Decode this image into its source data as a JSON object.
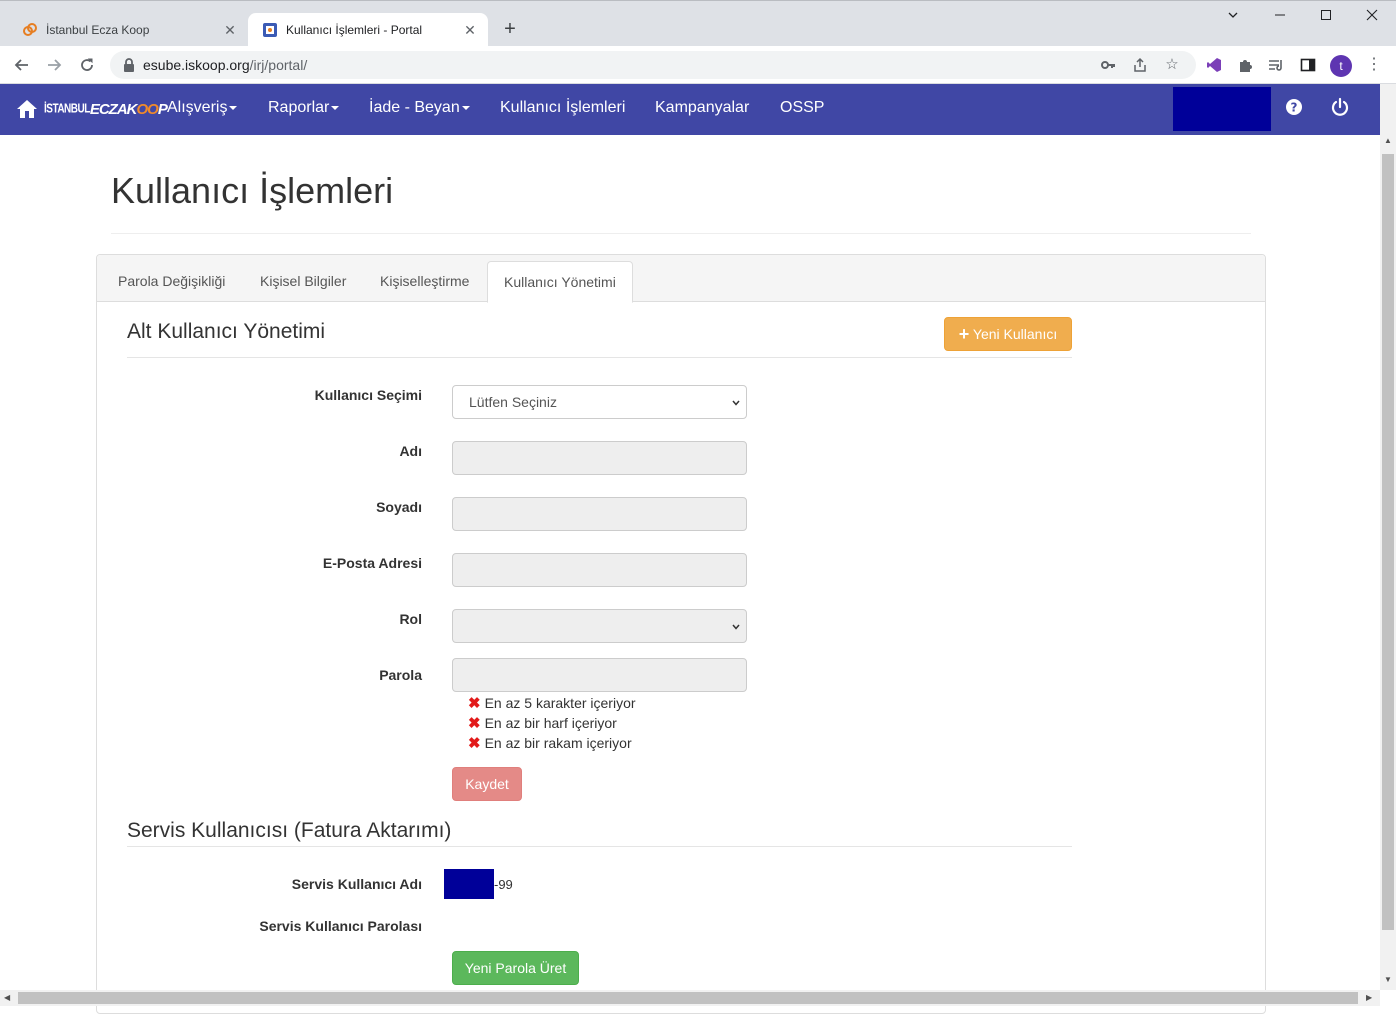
{
  "browser": {
    "tabs": [
      {
        "title": "İstanbul Ecza Koop",
        "active": false
      },
      {
        "title": "Kullanıcı İşlemleri - Portal",
        "active": true
      }
    ],
    "url_host": "esube.iskoop.org",
    "url_path": "/irj/portal/",
    "profile_initial": "t"
  },
  "navbar": {
    "brand": {
      "part1": "İSTANBUL",
      "part2": "ECZAK",
      "part3": "OO",
      "part4": "P"
    },
    "items": [
      {
        "label": "Alışveriş",
        "dropdown": true
      },
      {
        "label": "Raporlar",
        "dropdown": true
      },
      {
        "label": "İade - Beyan",
        "dropdown": true
      },
      {
        "label": "Kullanıcı İşlemleri",
        "dropdown": false
      },
      {
        "label": "Kampanyalar",
        "dropdown": false
      },
      {
        "label": "OSSP",
        "dropdown": false
      }
    ]
  },
  "page": {
    "title": "Kullanıcı İşlemleri",
    "tabs": [
      "Parola Değişikliği",
      "Kişisel Bilgiler",
      "Kişiselleştirme",
      "Kullanıcı Yönetimi"
    ],
    "active_tab": "Kullanıcı Yönetimi"
  },
  "sub_users": {
    "title": "Alt Kullanıcı Yönetimi",
    "new_user_button": "Yeni Kullanıcı",
    "fields": {
      "user_select_label": "Kullanıcı Seçimi",
      "user_select_value": "Lütfen Seçiniz",
      "first_name_label": "Adı",
      "last_name_label": "Soyadı",
      "email_label": "E-Posta Adresi",
      "role_label": "Rol",
      "password_label": "Parola"
    },
    "password_rules": [
      "En az 5 karakter içeriyor",
      "En az bir harf içeriyor",
      "En az bir rakam içeriyor"
    ],
    "save_button": "Kaydet"
  },
  "service_user": {
    "title": "Servis Kullanıcısı (Fatura Aktarımı)",
    "name_label": "Servis Kullanıcı Adı",
    "name_suffix": "-99",
    "password_label": "Servis Kullanıcı Parolası",
    "generate_button": "Yeni Parola Üret"
  },
  "colors": {
    "navbar": "#4047a5",
    "redaction": "#000099",
    "warning": "#f0ad4e",
    "danger": "#e48a87",
    "success": "#5cb85c",
    "error_mark": "#e21a1a"
  }
}
